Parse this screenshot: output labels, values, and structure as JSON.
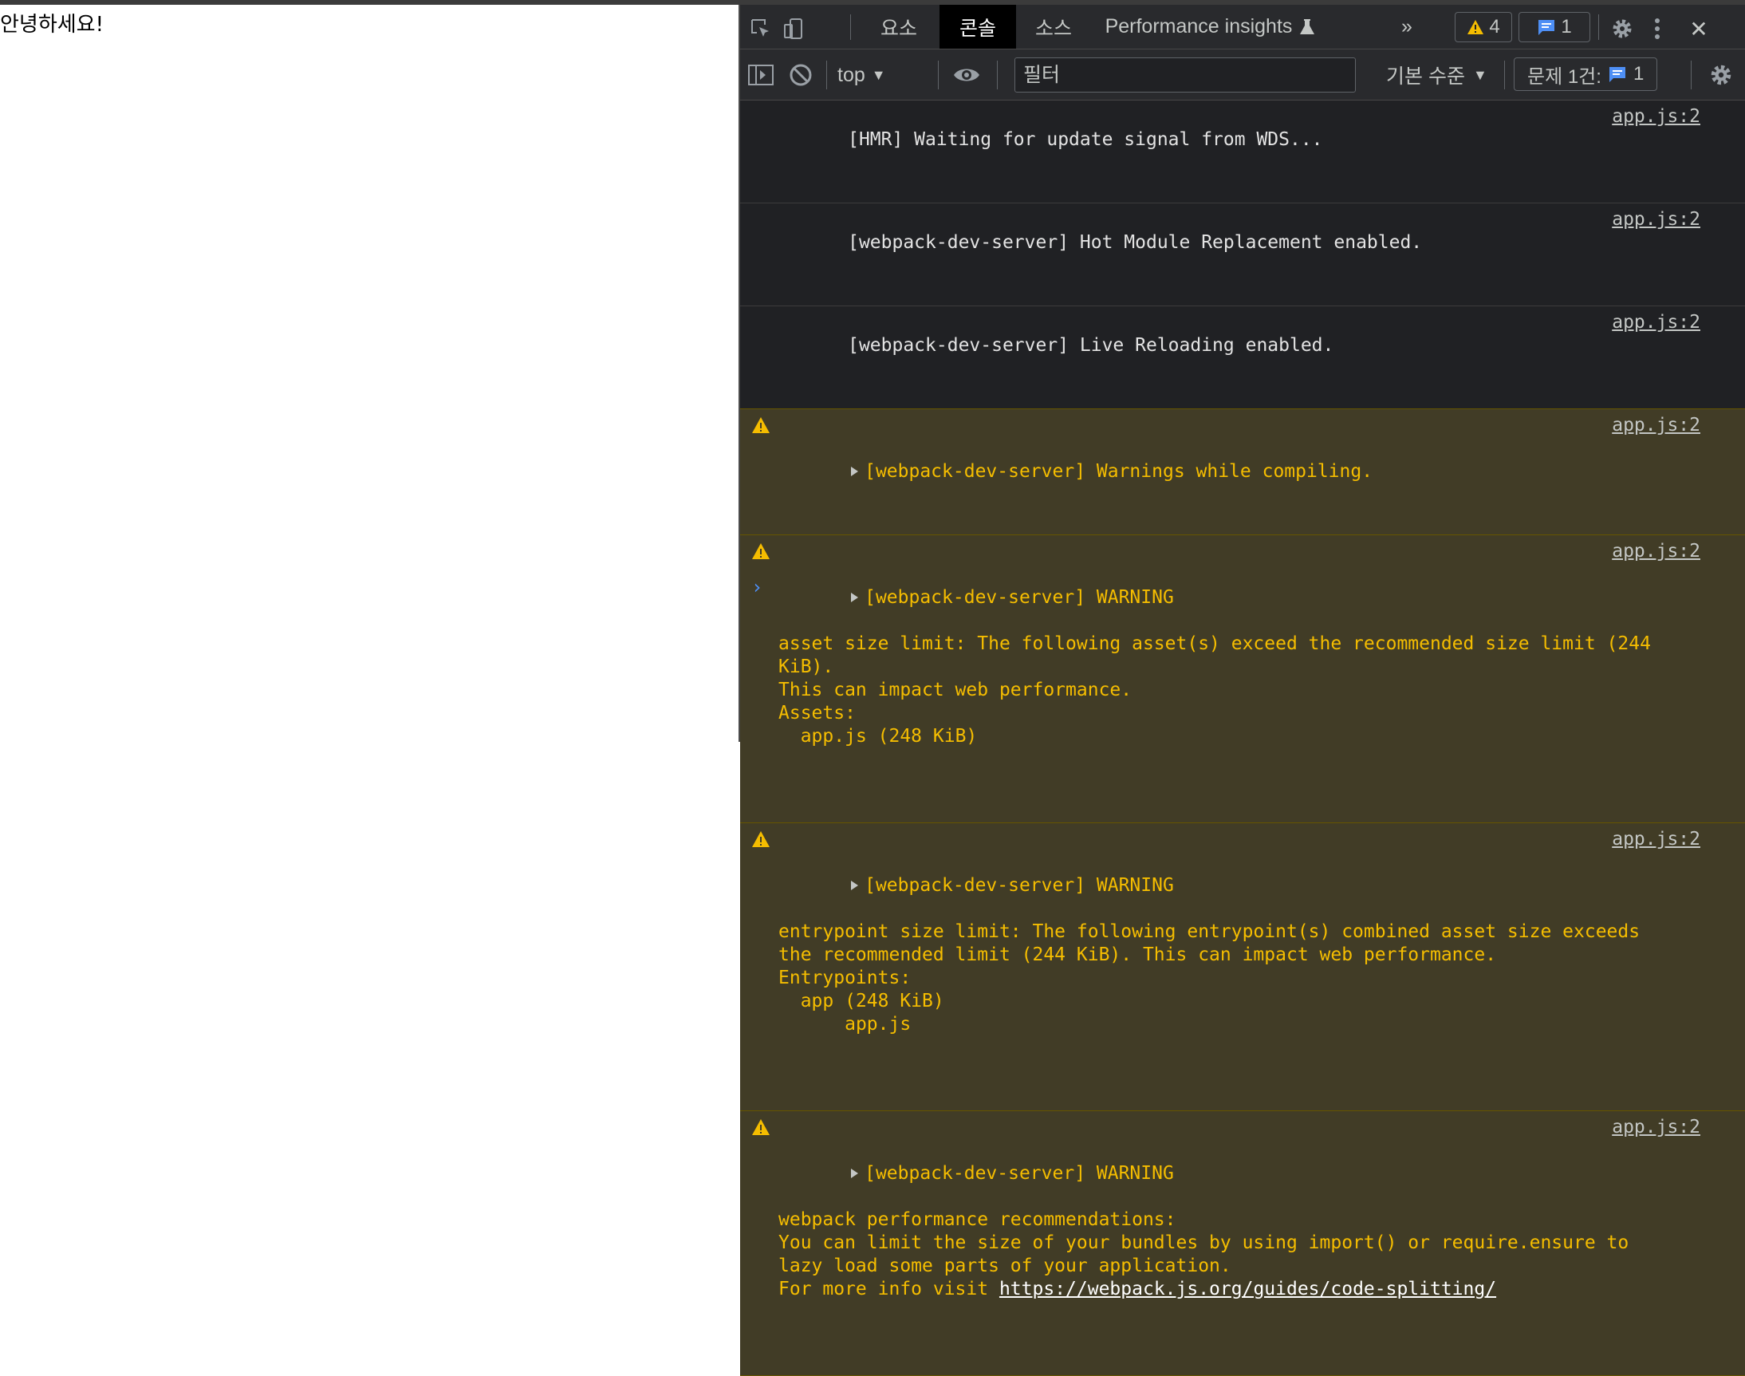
{
  "page": {
    "greeting": "안녕하세요!"
  },
  "devtools": {
    "tabs": [
      {
        "label": "요소"
      },
      {
        "label": "콘솔"
      },
      {
        "label": "소스"
      },
      {
        "label": "Performance insights"
      }
    ],
    "more_tabs_glyph": "»",
    "warning_count": "4",
    "message_count": "1",
    "close_glyph": "✕"
  },
  "console_toolbar": {
    "context": "top",
    "filter_placeholder": "필터",
    "level": "기본 수준",
    "issues_label": "문제 1건:",
    "issues_count": "1"
  },
  "messages": [
    {
      "type": "log",
      "text": "[HMR] Waiting for update signal from WDS...",
      "source": "app.js:2"
    },
    {
      "type": "log",
      "text": "[webpack-dev-server] Hot Module Replacement enabled.",
      "source": "app.js:2"
    },
    {
      "type": "log",
      "text": "[webpack-dev-server] Live Reloading enabled.",
      "source": "app.js:2"
    },
    {
      "type": "warning",
      "head": "[webpack-dev-server] Warnings while compiling.",
      "body": "",
      "source": "app.js:2"
    },
    {
      "type": "warning",
      "head": "[webpack-dev-server] WARNING",
      "body": "asset size limit: The following asset(s) exceed the recommended size limit (244\nKiB).\nThis can impact web performance.\nAssets:\n  app.js (248 KiB)",
      "source": "app.js:2"
    },
    {
      "type": "warning",
      "head": "[webpack-dev-server] WARNING",
      "body": "entrypoint size limit: The following entrypoint(s) combined asset size exceeds\nthe recommended limit (244 KiB). This can impact web performance.\nEntrypoints:\n  app (248 KiB)\n      app.js",
      "source": "app.js:2"
    },
    {
      "type": "warning",
      "head": "[webpack-dev-server] WARNING",
      "body": "webpack performance recommendations:\nYou can limit the size of your bundles by using import() or require.ensure to\nlazy load some parts of your application.\nFor more info visit ",
      "link": "https://webpack.js.org/guides/code-splitting/",
      "source": "app.js:2"
    }
  ],
  "prompt_glyph": "›",
  "colors": {
    "warning_text": "#f5bd00",
    "warning_bg": "#413c26",
    "accent_blue": "#4e8ff5",
    "active_tab": "#000000"
  }
}
